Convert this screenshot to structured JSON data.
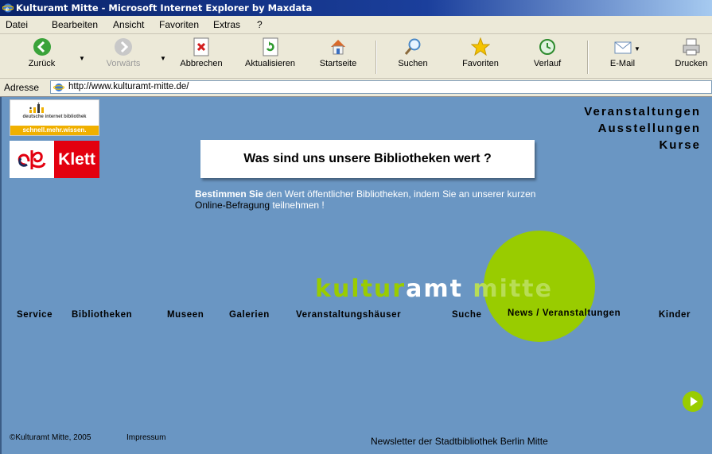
{
  "window": {
    "title": "Kulturamt Mitte - Microsoft Internet Explorer by Maxdata"
  },
  "menu": [
    "Datei",
    "Bearbeiten",
    "Ansicht",
    "Favoriten",
    "Extras",
    "?"
  ],
  "toolbar": {
    "back": "Zurück",
    "forward": "Vorwärts",
    "stop": "Abbrechen",
    "refresh": "Aktualisieren",
    "home": "Startseite",
    "search": "Suchen",
    "favorites": "Favoriten",
    "history": "Verlauf",
    "mail": "E-Mail",
    "print": "Drucken"
  },
  "address": {
    "label": "Adresse",
    "url": "http://www.kulturamt-mitte.de/"
  },
  "page": {
    "dib_logo": {
      "text": "deutsche internet bibliothek",
      "tagline": "schnell.mehr.wissen."
    },
    "klett_logo": "Klett",
    "top_links": [
      "Veranstaltungen",
      "Ausstellungen",
      "Kurse"
    ],
    "banner": "Was sind uns unsere Bibliotheken wert ?",
    "survey": {
      "bold": "Bestimmen Sie",
      "text1": " den Wert öffentlicher Bibliotheken, indem Sie an unserer kurzen ",
      "link": "Online-Befragung",
      "text2": " teilnehmen !"
    },
    "logo": {
      "part1": "kultur",
      "part2": "amt",
      "part3": " mitte"
    },
    "nav": [
      "Service",
      "Bibliotheken",
      "Museen",
      "Galerien",
      "Veranstaltungshäuser",
      "Suche",
      "News / Veranstaltungen",
      "Kinder"
    ],
    "footer": {
      "copyright": "©Kulturamt Mitte, 2005",
      "impressum": "Impressum",
      "newsletter": "Newsletter der Stadtbibliothek Berlin Mitte"
    }
  },
  "colors": {
    "page_bg": "#6a96c3",
    "accent_green": "#99cc00",
    "klett_red": "#e3000f"
  },
  "icons": [
    "ie-icon",
    "back-arrow-icon",
    "forward-arrow-icon",
    "stop-icon",
    "refresh-icon",
    "home-icon",
    "search-icon",
    "favorites-star-icon",
    "history-icon",
    "mail-icon",
    "print-icon",
    "play-icon"
  ]
}
